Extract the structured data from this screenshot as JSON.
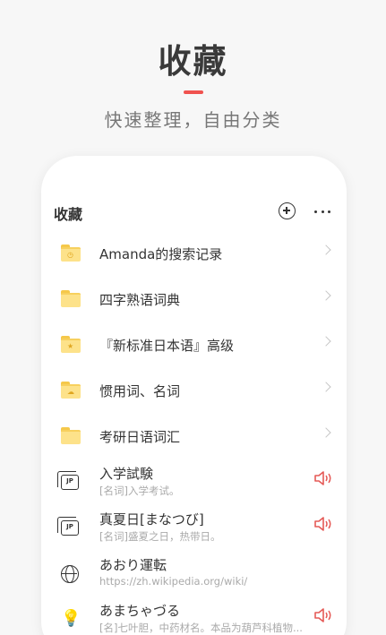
{
  "hero": {
    "title": "收藏",
    "subtitle": "快速整理，自由分类"
  },
  "card": {
    "title": "收藏",
    "add_icon": "plus-circle-icon",
    "more_icon": "more-dots-icon"
  },
  "folders": [
    {
      "label": "Amanda的搜索记录",
      "icon": "folder-clock-icon"
    },
    {
      "label": "四字熟语词典",
      "icon": "folder-icon"
    },
    {
      "label": "『新标准日本语』高级",
      "icon": "folder-star-icon"
    },
    {
      "label": "惯用词、名词",
      "icon": "folder-cloud-icon"
    },
    {
      "label": "考研日语词汇",
      "icon": "folder-icon"
    }
  ],
  "entries": [
    {
      "word": "入学試験",
      "definition": "[名词]入学考试。",
      "icon": "jp-dictionary-icon",
      "has_audio": true
    },
    {
      "word": "真夏日[まなつび]",
      "definition": "[名词]盛夏之日，热带日。",
      "icon": "jp-dictionary-icon",
      "has_audio": true
    },
    {
      "word": "あおり運転",
      "definition": "https://zh.wikipedia.org/wiki/",
      "icon": "globe-icon",
      "has_audio": false
    },
    {
      "word": "あまちゃづる",
      "definition": "[名]七叶胆，中药材名。本品为葫芦科植物...",
      "icon": "lightbulb-icon",
      "has_audio": true
    }
  ],
  "colors": {
    "accent": "#f0524f",
    "folder": "#fde28a",
    "speaker": "#e55a57"
  }
}
